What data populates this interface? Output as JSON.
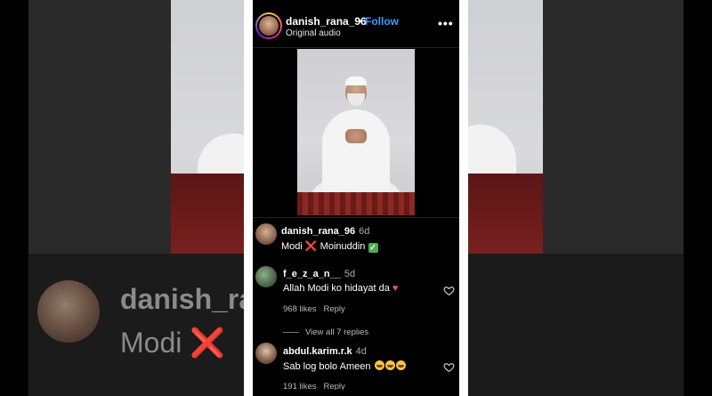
{
  "post": {
    "username": "danish_rana_96",
    "separator": "•",
    "follow_label": "Follow",
    "audio": "Original audio",
    "more_icon": "more-options-icon",
    "more_label": "•••"
  },
  "background": {
    "large_username": "danish_ra",
    "large_caption_start": "Modi",
    "large_x": "❌"
  },
  "caption": {
    "username": "danish_rana_96",
    "time": "6d",
    "text_start": "Modi",
    "x_mark": "❌",
    "text_name": "Moinuddin",
    "check": "✓"
  },
  "comments": [
    {
      "username": "f_e_z_a_n__",
      "time": "5d",
      "text": "Allah Modi ko hidayat da",
      "emoji": "♥",
      "likes": "968 likes",
      "reply": "Reply"
    },
    {
      "username": "abdul.karim.r.k",
      "time": "4d",
      "text": "Sab log bolo Ameen",
      "likes": "191 likes",
      "reply": "Reply"
    }
  ],
  "view_replies": "View all 7 replies",
  "colors": {
    "follow": "#3b9bff",
    "background": "#000000"
  }
}
